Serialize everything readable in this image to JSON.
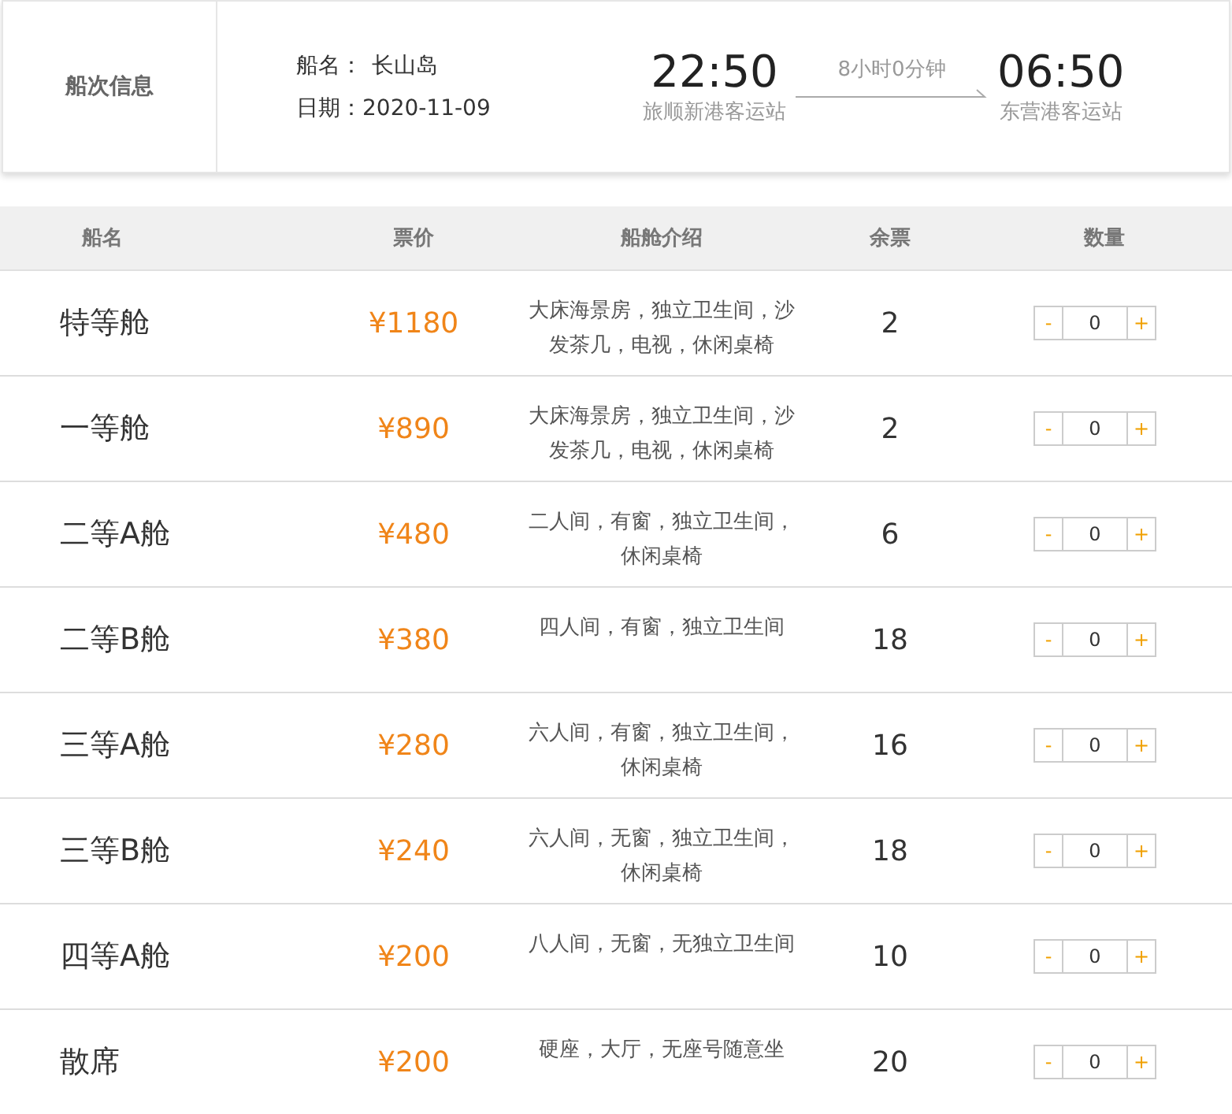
{
  "voyage": {
    "section_label": "船次信息",
    "ship_label": "船名：",
    "ship_name": "长山岛",
    "date_label": "日期：",
    "date": "2020-11-09",
    "depart_time": "22:50",
    "depart_port": "旅顺新港客运站",
    "duration": "8小时0分钟",
    "arrive_time": "06:50",
    "arrive_port": "东营港客运站"
  },
  "table": {
    "columns": [
      "船名",
      "票价",
      "船舱介绍",
      "余票",
      "数量"
    ],
    "rows": [
      {
        "cabin": "特等舱",
        "price": "¥1180",
        "intro": "大床海景房，独立卫生间，沙发茶几，电视，休闲桌椅",
        "remaining": "2",
        "quantity": {
          "minus": "-",
          "value": "0",
          "plus": "+"
        }
      },
      {
        "cabin": "一等舱",
        "price": "¥890",
        "intro": "大床海景房，独立卫生间，沙发茶几，电视，休闲桌椅",
        "remaining": "2",
        "quantity": {
          "minus": "-",
          "value": "0",
          "plus": "+"
        }
      },
      {
        "cabin": "二等A舱",
        "price": "¥480",
        "intro": "二人间，有窗，独立卫生间，休闲桌椅",
        "remaining": "6",
        "quantity": {
          "minus": "-",
          "value": "0",
          "plus": "+"
        }
      },
      {
        "cabin": "二等B舱",
        "price": "¥380",
        "intro": "四人间，有窗，独立卫生间",
        "remaining": "18",
        "quantity": {
          "minus": "-",
          "value": "0",
          "plus": "+"
        }
      },
      {
        "cabin": "三等A舱",
        "price": "¥280",
        "intro": "六人间，有窗，独立卫生间，休闲桌椅",
        "remaining": "16",
        "quantity": {
          "minus": "-",
          "value": "0",
          "plus": "+"
        }
      },
      {
        "cabin": "三等B舱",
        "price": "¥240",
        "intro": "六人间，无窗，独立卫生间，休闲桌椅",
        "remaining": "18",
        "quantity": {
          "minus": "-",
          "value": "0",
          "plus": "+"
        }
      },
      {
        "cabin": "四等A舱",
        "price": "¥200",
        "intro": "八人间，无窗，无独立卫生间",
        "remaining": "10",
        "quantity": {
          "minus": "-",
          "value": "0",
          "plus": "+"
        }
      },
      {
        "cabin": "散席",
        "price": "¥200",
        "intro": "硬座，大厅，无座号随意坐",
        "remaining": "20",
        "quantity": {
          "minus": "-",
          "value": "0",
          "plus": "+"
        }
      }
    ]
  }
}
